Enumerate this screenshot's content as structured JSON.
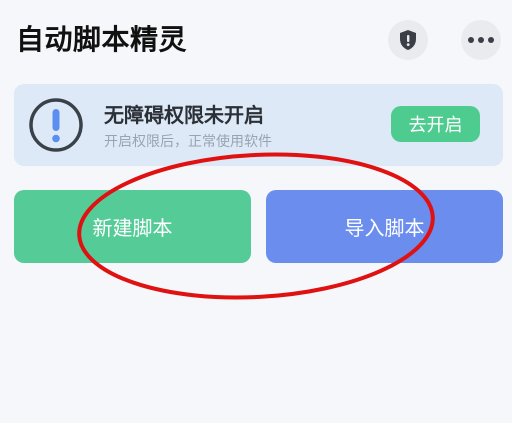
{
  "header": {
    "title": "自动脚本精灵",
    "shield_icon": "shield-icon",
    "more_icon": "more-horizontal-icon"
  },
  "banner": {
    "icon": "exclamation-circle-icon",
    "title": "无障碍权限未开启",
    "subtitle": "开启权限后，正常使用软件",
    "button_label": "去开启"
  },
  "actions": {
    "new_label": "新建脚本",
    "import_label": "导入脚本"
  },
  "colors": {
    "background": "#f6f7fa",
    "banner_bg": "#dde9f7",
    "accent_green": "#4ecb8f",
    "new_button": "#55cc98",
    "import_button": "#6b8dee",
    "annotation_red": "#e01111"
  }
}
